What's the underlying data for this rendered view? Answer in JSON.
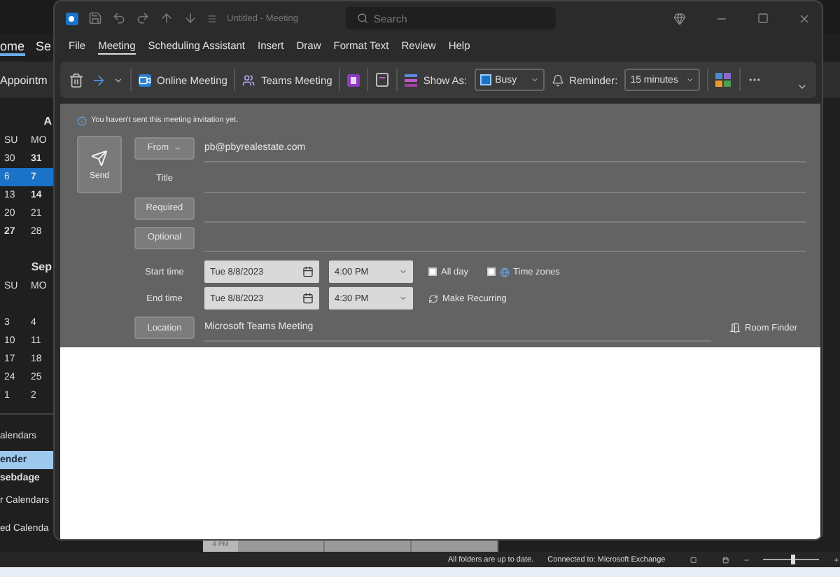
{
  "background_app": {
    "tabs": [
      {
        "label": "ome",
        "selected": true
      },
      {
        "label": "Se",
        "selected": false
      }
    ],
    "new_button": "Appointm",
    "mini_calendars": [
      {
        "month": "A",
        "weekdays": [
          "SU",
          "MO"
        ],
        "weeks": [
          {
            "selected": false,
            "days": [
              {
                "d": "30",
                "bold": false
              },
              {
                "d": "31",
                "bold": true
              }
            ]
          },
          {
            "selected": true,
            "days": [
              {
                "d": "6",
                "bold": false
              },
              {
                "d": "7",
                "bold": true
              }
            ]
          },
          {
            "selected": false,
            "days": [
              {
                "d": "13",
                "bold": false
              },
              {
                "d": "14",
                "bold": true
              }
            ]
          },
          {
            "selected": false,
            "days": [
              {
                "d": "20",
                "bold": false
              },
              {
                "d": "21",
                "bold": false
              }
            ]
          },
          {
            "selected": false,
            "days": [
              {
                "d": "27",
                "bold": true
              },
              {
                "d": "28",
                "bold": false
              }
            ]
          }
        ]
      },
      {
        "month": "Sep",
        "weekdays": [
          "SU",
          "MO"
        ],
        "weeks": [
          {
            "selected": false,
            "days": [
              {
                "d": "3",
                "bold": false
              },
              {
                "d": "4",
                "bold": false
              }
            ]
          },
          {
            "selected": false,
            "days": [
              {
                "d": "10",
                "bold": false
              },
              {
                "d": "11",
                "bold": false
              }
            ]
          },
          {
            "selected": false,
            "days": [
              {
                "d": "17",
                "bold": false
              },
              {
                "d": "18",
                "bold": false
              }
            ]
          },
          {
            "selected": false,
            "days": [
              {
                "d": "24",
                "bold": false
              },
              {
                "d": "25",
                "bold": false
              }
            ]
          },
          {
            "selected": false,
            "days": [
              {
                "d": "1",
                "bold": false
              },
              {
                "d": "2",
                "bold": false
              }
            ]
          }
        ]
      }
    ],
    "calendar_groups": [
      {
        "label": "alendars",
        "children": [
          {
            "label": "ender",
            "selected": true
          },
          {
            "label": "sebdage",
            "selected": false
          }
        ]
      },
      {
        "label": "r Calendars"
      },
      {
        "label": "ed Calenda"
      }
    ],
    "grid_label": "4 PM",
    "status_bar": {
      "texts": [
        "All folders are up to date.",
        "Connected to: Microsoft Exchange"
      ],
      "zoom": {
        "level": 0.5
      }
    }
  },
  "meeting_window": {
    "title": "Untitled  -  Meeting",
    "search": {
      "placeholder": "Search"
    },
    "menu": [
      {
        "label": "File",
        "selected": false
      },
      {
        "label": "Meeting",
        "selected": true
      },
      {
        "label": "Scheduling Assistant",
        "selected": false
      },
      {
        "label": "Insert",
        "selected": false
      },
      {
        "label": "Draw",
        "selected": false
      },
      {
        "label": "Format Text",
        "selected": false
      },
      {
        "label": "Review",
        "selected": false
      },
      {
        "label": "Help",
        "selected": false
      }
    ],
    "ribbon": {
      "online_meeting": "Online Meeting",
      "teams_meeting": "Teams Meeting",
      "show_as_label": "Show As:",
      "show_as": "Busy",
      "reminder_label": "Reminder:",
      "reminder": "15 minutes"
    },
    "info": "You haven't sent this meeting invitation yet.",
    "send": "Send",
    "from": {
      "button": "From",
      "value": "pb@pbyrealestate.com"
    },
    "title_label": "Title",
    "required": "Required",
    "optional": "Optional",
    "start": {
      "label": "Start time",
      "date": "Tue 8/8/2023",
      "time": "4:00 PM"
    },
    "end": {
      "label": "End time",
      "date": "Tue 8/8/2023",
      "time": "4:30 PM"
    },
    "all_day": {
      "label": "All day",
      "checked": false
    },
    "time_zones": {
      "label": "Time zones",
      "checked": false
    },
    "make_recurring": "Make Recurring",
    "location": {
      "button": "Location",
      "value": "Microsoft Teams Meeting"
    },
    "room_finder": "Room Finder"
  }
}
